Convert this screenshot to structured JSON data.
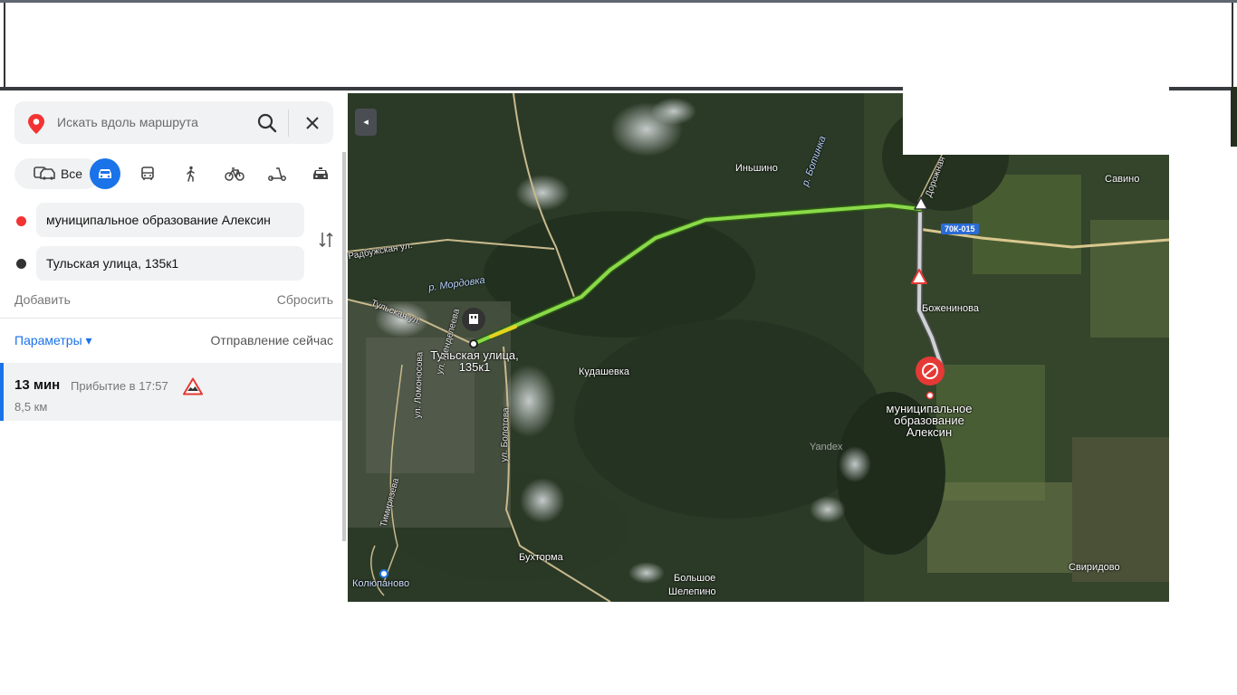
{
  "search": {
    "placeholder": "Искать вдоль маршрута"
  },
  "modes": {
    "all_label": "Все"
  },
  "route": {
    "from": "муниципальное образование Алексин",
    "to": "Тульская улица, 135к1",
    "add_label": "Добавить",
    "reset_label": "Сбросить",
    "params_label": "Параметры ▾",
    "departure_label": "Отправление сейчас"
  },
  "result": {
    "time": "13 мин",
    "arrival": "Прибытие в 17:57",
    "distance": "8,5 км"
  },
  "colors": {
    "accent": "#1a73e8",
    "start_dot": "#f33333",
    "end_dot": "#333333",
    "route_line": "#8ad94a"
  },
  "map": {
    "start_label": "Тульская улица,\n135к1",
    "end_label": "муниципальное\nобразование\nАлексин",
    "watermark": "Yandex",
    "road_badge": "70К-015",
    "places": {
      "inshino": "Иньшино",
      "savino": "Савино",
      "bozheninovo": "Боженинова",
      "kudashevka": "Кудашевка",
      "bukhtorma": "Бухторма",
      "bolshoe": "Большое",
      "shelepino": "Шелепино",
      "sviridovo": "Свиридово",
      "kolyupanovo": "Колюпаново"
    },
    "streets": {
      "radbuzhskaya": "Радбужская ул.",
      "tulskaya": "Тульская ул.",
      "bolotova": "ул. Болотова",
      "timiryazev": "Тимирязева",
      "lomonosova": "ул. Ломоносова",
      "mendeleeva": "ул. Менделеева",
      "dorozhnaya": "Дорожная"
    },
    "rivers": {
      "mordovka": "р. Мордовка",
      "botinka": "р. Ботинка"
    }
  }
}
